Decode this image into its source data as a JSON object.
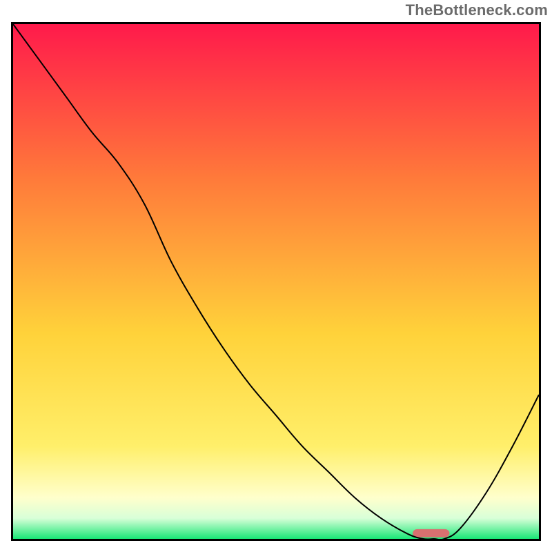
{
  "watermark": "TheBottleneck.com",
  "colors": {
    "gradient_top": "#ff1a4b",
    "gradient_mid_upper": "#ff7a3a",
    "gradient_mid": "#ffd23a",
    "gradient_lower_yellow": "#ffef6a",
    "gradient_pale_yellow": "#ffffcc",
    "gradient_pale_green": "#d8ffd8",
    "gradient_green": "#19e676",
    "curve": "#000000",
    "marker": "#d87070",
    "frame": "#000000"
  },
  "chart_data": {
    "type": "line",
    "title": "",
    "xlabel": "",
    "ylabel": "",
    "xlim": [
      0,
      100
    ],
    "ylim": [
      0,
      100
    ],
    "x": [
      0,
      5,
      10,
      15,
      20,
      25,
      30,
      35,
      40,
      45,
      50,
      55,
      60,
      65,
      70,
      75,
      78,
      80,
      82,
      85,
      90,
      95,
      100
    ],
    "values": [
      100,
      93,
      86,
      79,
      73,
      65,
      54,
      45,
      37,
      30,
      24,
      18,
      13,
      8,
      4,
      1,
      0,
      0,
      0,
      2,
      9,
      18,
      28
    ],
    "marker": {
      "x_start": 76,
      "x_end": 83,
      "y": 0.5
    },
    "annotations": []
  }
}
